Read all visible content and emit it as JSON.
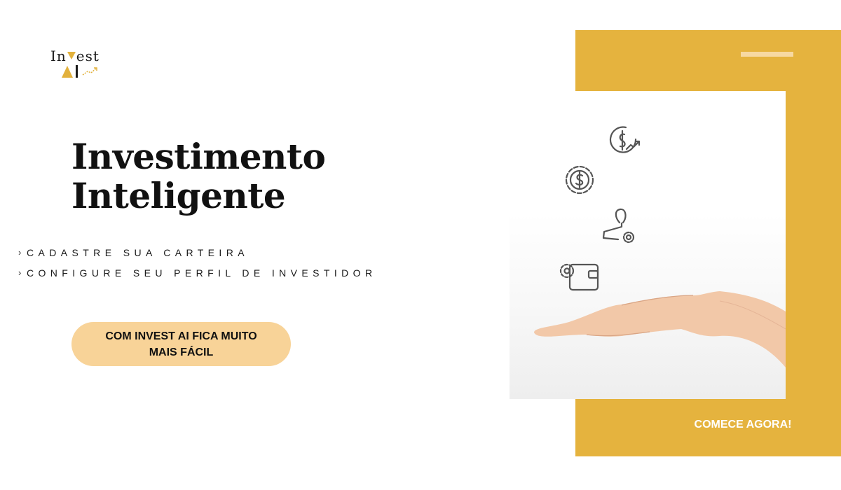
{
  "brand": {
    "logo_top": "Invest",
    "logo_bottom": "AI"
  },
  "hero": {
    "title_line1": "Investimento",
    "title_line2": "Inteligente"
  },
  "steps": [
    "CADASTRE SUA CARTEIRA",
    "CONFIGURE SEU PERFIL DE INVESTIDOR"
  ],
  "cta": {
    "label": "COM INVEST AI FICA MUITO MAIS FÁCIL"
  },
  "start": {
    "label": "COMECE AGORA!"
  },
  "illustration": {
    "icons": [
      "dollar-growth-icon",
      "dollar-gear-icon",
      "investor-settings-icon",
      "wallet-settings-icon"
    ]
  },
  "colors": {
    "accent_gold": "#e5b33e",
    "pill": "#f8d398",
    "text": "#111111"
  }
}
